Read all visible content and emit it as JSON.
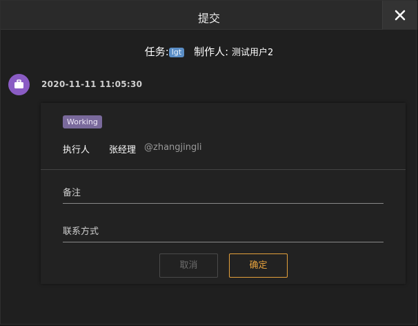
{
  "dialog": {
    "title": "提交",
    "close_icon": "close-icon"
  },
  "meta": {
    "task_label": "任务:",
    "task_tag": "lgt",
    "maker_label": "制作人:",
    "maker_name": "测试用户2"
  },
  "entry": {
    "avatar_icon": "briefcase-icon",
    "avatar_color": "#8a5cc4",
    "timestamp": "2020-11-11 11:05:30",
    "status": "Working",
    "status_color": "#7a6a9c",
    "executor_label": "执行人",
    "executor_name": "张经理",
    "executor_handle": "@zhangjingli"
  },
  "form": {
    "remark_placeholder": "备注",
    "remark_value": "",
    "contact_placeholder": "联系方式",
    "contact_value": "",
    "cancel_label": "取消",
    "confirm_label": "确定",
    "accent_color": "#e6a23c"
  }
}
